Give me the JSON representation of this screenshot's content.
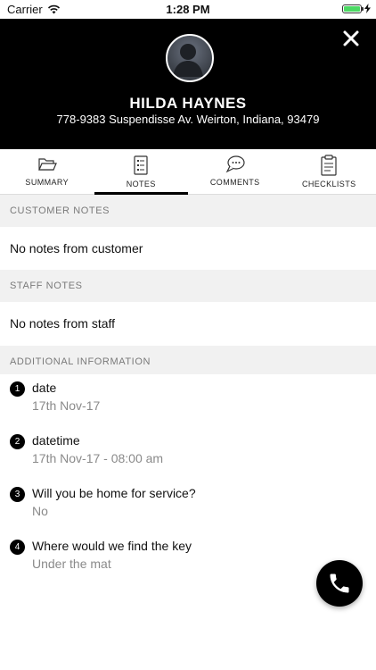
{
  "status_bar": {
    "carrier": "Carrier",
    "time": "1:28 PM"
  },
  "customer": {
    "name": "HILDA HAYNES",
    "address": "778-9383 Suspendisse Av. Weirton, Indiana, 93479"
  },
  "tabs": [
    {
      "label": "SUMMARY",
      "icon": "folder-icon"
    },
    {
      "label": "NOTES",
      "icon": "notes-icon",
      "active": true
    },
    {
      "label": "COMMENTS",
      "icon": "comments-icon"
    },
    {
      "label": "CHECKLISTS",
      "icon": "clipboard-icon"
    }
  ],
  "customer_notes": {
    "header": "CUSTOMER NOTES",
    "text": "No notes from customer"
  },
  "staff_notes": {
    "header": "STAFF NOTES",
    "text": "No notes from staff"
  },
  "additional_info": {
    "header": "ADDITIONAL INFORMATION",
    "items": [
      {
        "number": "1",
        "question": "date",
        "answer": "17th Nov-17"
      },
      {
        "number": "2",
        "question": "datetime",
        "answer": "17th Nov-17 - 08:00 am"
      },
      {
        "number": "3",
        "question": "Will you be home for service?",
        "answer": "No"
      },
      {
        "number": "4",
        "question": "Where would we find the key",
        "answer": "Under the mat"
      }
    ]
  },
  "colors": {
    "header_bg": "#000000",
    "battery_fill": "#4cd964",
    "section_bg": "#f1f1f1"
  }
}
